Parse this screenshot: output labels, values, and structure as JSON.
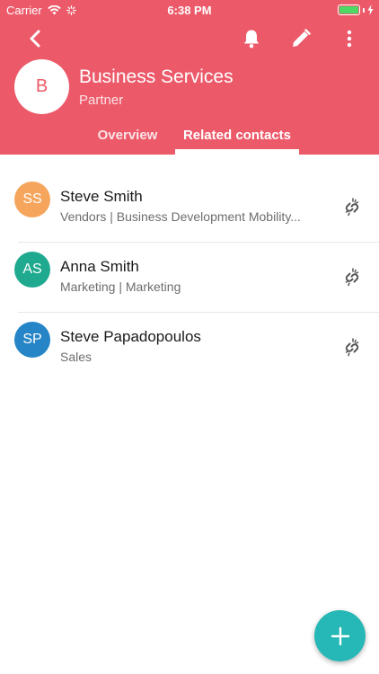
{
  "status_bar": {
    "carrier": "Carrier",
    "time": "6:38 PM",
    "battery_color": "#4cd964"
  },
  "toolbar": {
    "back_icon": "chevron-left-icon",
    "notifications_icon": "bell-icon",
    "edit_icon": "pencil-icon",
    "more_icon": "more-vertical-icon"
  },
  "entity": {
    "initial": "B",
    "name": "Business Services",
    "role": "Partner"
  },
  "tabs": [
    {
      "label": "Overview",
      "active": false
    },
    {
      "label": "Related contacts",
      "active": true
    }
  ],
  "contacts": [
    {
      "initials": "SS",
      "name": "Steve Smith",
      "subtitle": "Vendors | Business Development Mobility...",
      "avatar_color": "#f6a55d"
    },
    {
      "initials": "AS",
      "name": "Anna Smith",
      "subtitle": "Marketing | Marketing",
      "avatar_color": "#1faa8f"
    },
    {
      "initials": "SP",
      "name": "Steve Papadopoulos",
      "subtitle": "Sales",
      "avatar_color": "#2585c6"
    }
  ],
  "colors": {
    "header": "#ec5a6a",
    "fab": "#26b8b6"
  },
  "fab_icon": "plus-icon"
}
